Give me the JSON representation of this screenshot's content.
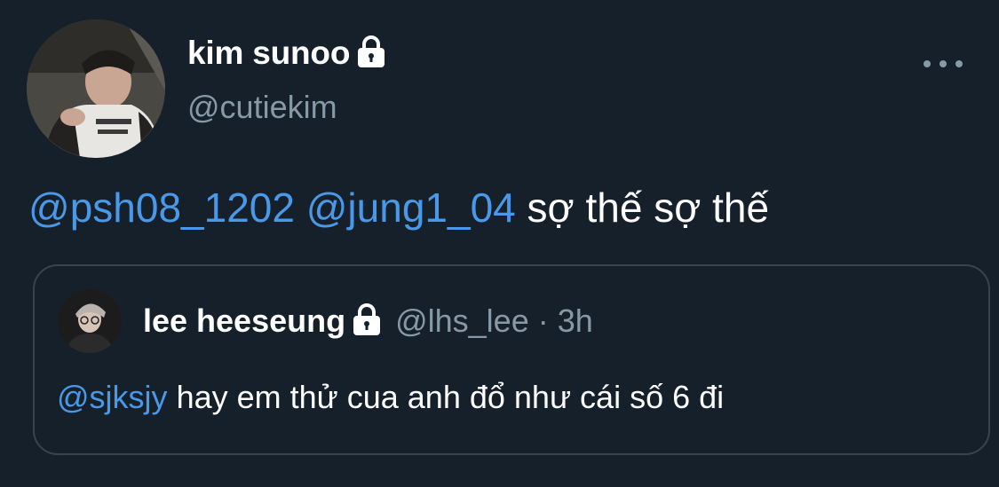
{
  "tweet": {
    "display_name": "kim sunoo",
    "handle": "@cutiekim",
    "text": {
      "mention_1": "@psh08_1202",
      "mention_2": "@jung1_04",
      "body": "sợ thế sợ thế"
    },
    "avatar_icon": "profile-photo",
    "lock_icon": "lock-icon",
    "more_icon": "ellipsis-icon"
  },
  "quoted_tweet": {
    "display_name": "lee heeseung",
    "handle": "@lhs_lee",
    "separator": "·",
    "time": "3h",
    "text": {
      "mention": "@sjksjy",
      "body": "hay em thử cua anh đổ như cái số 6 đi"
    }
  },
  "colors": {
    "background": "#15202b",
    "mention": "#4a99e9",
    "secondary_text": "#8899a6",
    "border": "#38444d"
  }
}
